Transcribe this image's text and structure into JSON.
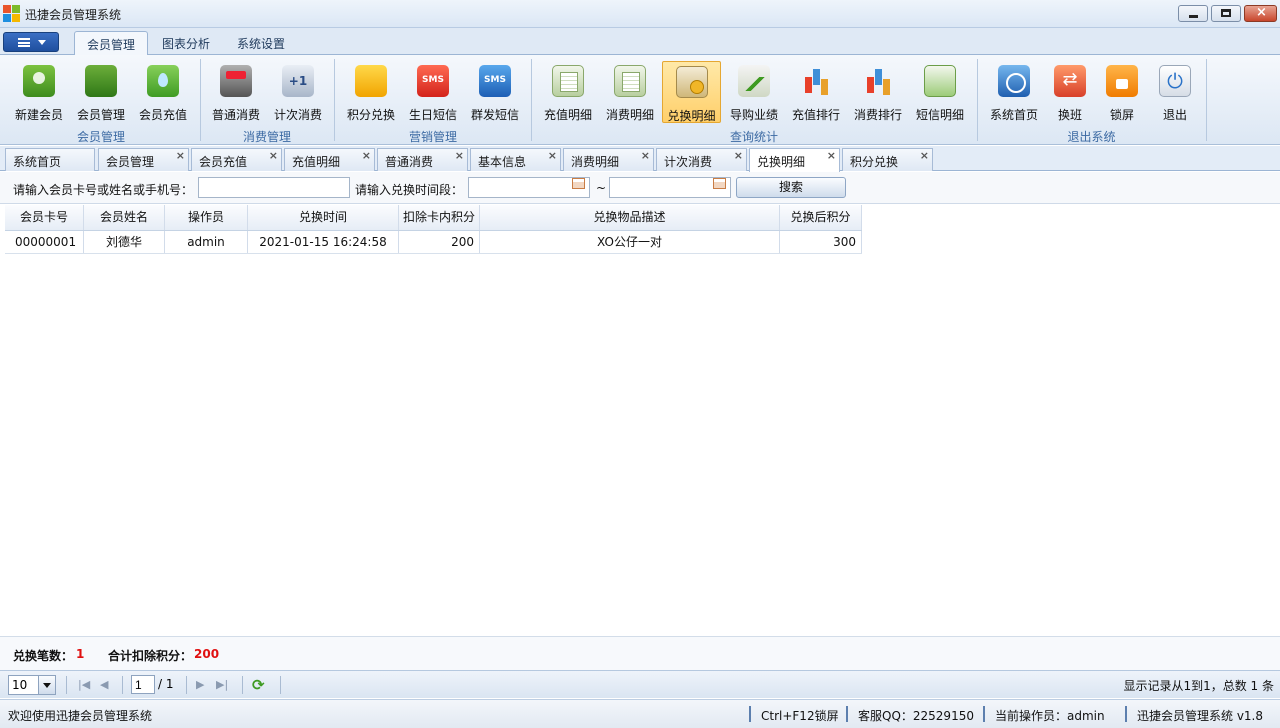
{
  "window": {
    "title": "迅捷会员管理系统"
  },
  "ribbon_tabs": [
    "会员管理",
    "图表分析",
    "系统设置"
  ],
  "ribbon": {
    "buttons": [
      "新建会员",
      "会员管理",
      "会员充值",
      "普通消费",
      "计次消费",
      "积分兑换",
      "生日短信",
      "群发短信",
      "充值明细",
      "消费明细",
      "兑换明细",
      "导购业绩",
      "充值排行",
      "消费排行",
      "短信明细",
      "系统首页",
      "换班",
      "锁屏",
      "退出"
    ],
    "groups": [
      "会员管理",
      "消费管理",
      "营销管理",
      "查询统计",
      "退出系统"
    ],
    "active_button": "兑换明细"
  },
  "doc_tabs": [
    "系统首页",
    "会员管理",
    "会员充值",
    "充值明细",
    "普通消费",
    "基本信息",
    "消费明细",
    "计次消费",
    "兑换明细",
    "积分兑换"
  ],
  "doc_tab_close": "×",
  "active_doc_tab": "兑换明细",
  "search": {
    "member_label": "请输入会员卡号或姓名或手机号：",
    "member_value": "",
    "time_label": "请输入兑换时间段：",
    "date_from": "",
    "date_to": "",
    "range_sep": "~",
    "button": "搜索"
  },
  "grid": {
    "columns": [
      "会员卡号",
      "会员姓名",
      "操作员",
      "兑换时间",
      "扣除卡内积分",
      "兑换物品描述",
      "兑换后积分"
    ],
    "rows": [
      [
        "00000001",
        "刘德华",
        "admin",
        "2021-01-15 16:24:58",
        "200",
        "XO公仔一对",
        "300"
      ]
    ]
  },
  "summary": {
    "count_label": "兑换笔数：",
    "count_value": "1",
    "points_label": "合计扣除积分：",
    "points_value": "200"
  },
  "pager": {
    "page_size": "10",
    "current_page": "1",
    "total_pages": "/ 1",
    "info": "显示记录从1到1，总数 1 条"
  },
  "status": {
    "welcome": "欢迎使用迅捷会员管理系统",
    "lock_hint": "Ctrl+F12锁屏",
    "qq": "客服QQ：22529150",
    "operator": "当前操作员：admin",
    "version": "迅捷会员管理系统 v1.8"
  },
  "colors": {
    "accent": "#1f4f9e",
    "highlight": "#ffcf6a",
    "alert": "#e01010"
  }
}
